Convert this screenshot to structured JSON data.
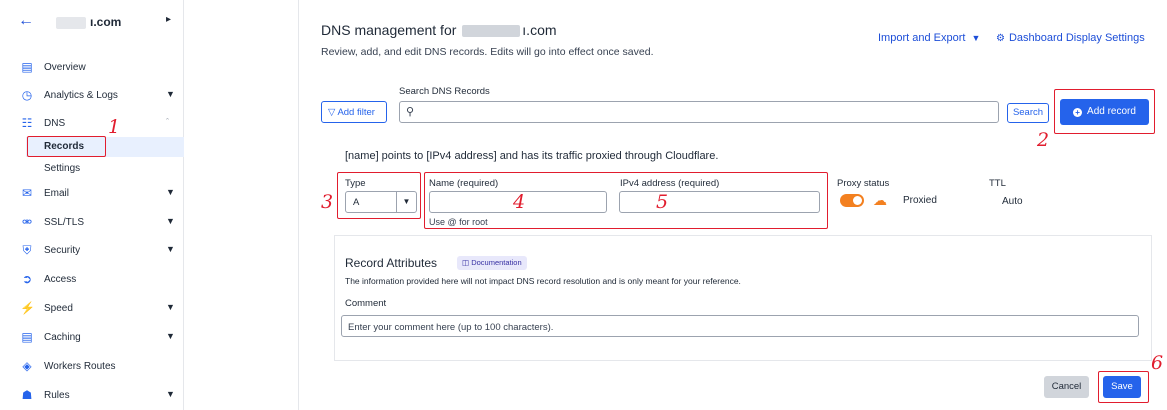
{
  "sidebar": {
    "domain_suffix": "ı.com",
    "items": [
      {
        "label": "Overview",
        "icon": "document-icon"
      },
      {
        "label": "Analytics & Logs",
        "icon": "clock-icon"
      },
      {
        "label": "DNS",
        "icon": "network-icon"
      },
      {
        "label": "Email",
        "icon": "mail-icon"
      },
      {
        "label": "SSL/TLS",
        "icon": "lock-icon"
      },
      {
        "label": "Security",
        "icon": "shield-icon"
      },
      {
        "label": "Access",
        "icon": "access-icon"
      },
      {
        "label": "Speed",
        "icon": "lightning-icon"
      },
      {
        "label": "Caching",
        "icon": "database-icon"
      },
      {
        "label": "Workers Routes",
        "icon": "workers-icon"
      },
      {
        "label": "Rules",
        "icon": "rules-icon"
      }
    ],
    "dns_sub": {
      "records": "Records",
      "settings": "Settings"
    }
  },
  "header": {
    "title_prefix": "DNS management for",
    "title_suffix": "ı.com",
    "subtitle": "Review, add, and edit DNS records. Edits will go into effect once saved.",
    "import_export": "Import and Export",
    "dashboard_settings": "Dashboard Display Settings"
  },
  "search": {
    "label": "Search DNS Records",
    "add_filter": "Add filter",
    "placeholder": "",
    "button": "Search",
    "add_record": "Add record"
  },
  "form": {
    "description": "[name] points to [IPv4 address] and has its traffic proxied through Cloudflare.",
    "type_label": "Type",
    "type_value": "A",
    "name_label": "Name (required)",
    "name_hint": "Use @ for root",
    "ipv4_label": "IPv4 address (required)",
    "proxy_label": "Proxy status",
    "proxy_value": "Proxied",
    "ttl_label": "TTL",
    "ttl_value": "Auto"
  },
  "attributes": {
    "title": "Record Attributes",
    "doc_badge": "Documentation",
    "note": "The information provided here will not impact DNS record resolution and is only meant for your reference.",
    "comment_label": "Comment",
    "comment_placeholder": "Enter your comment here (up to 100 characters)."
  },
  "actions": {
    "cancel": "Cancel",
    "save": "Save"
  },
  "annotations": [
    "1",
    "2",
    "3",
    "4",
    "5",
    "6"
  ],
  "colors": {
    "accent": "#2563eb",
    "annotation": "#e11d2e",
    "proxy": "#f38020"
  }
}
